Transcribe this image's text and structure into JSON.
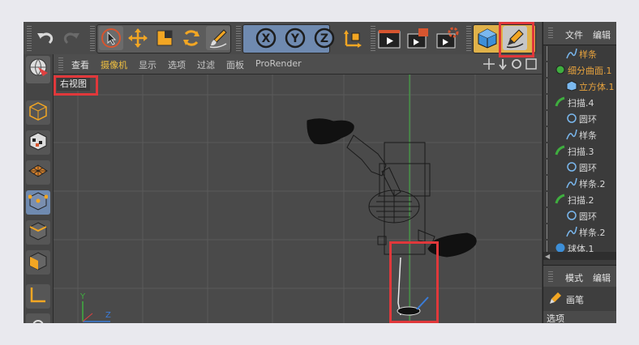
{
  "toolbar": {
    "undo_icon": "undo-icon",
    "redo_icon": "redo-icon",
    "tools": [
      "select-icon",
      "move-icon",
      "scale-icon",
      "rotate-icon",
      "brush-icon"
    ],
    "axes": [
      "X",
      "Y",
      "Z"
    ],
    "render_icons": [
      "render-view-icon",
      "render-picture-icon",
      "render-settings-icon"
    ],
    "cube_icon": "cube-icon",
    "pen_icon": "pen-tool-icon"
  },
  "viewport_menu": {
    "items": [
      "查看",
      "摄像机",
      "显示",
      "选项",
      "过滤",
      "面板",
      "ProRender"
    ],
    "view_name": "右视图"
  },
  "axis_labels": {
    "y": "Y",
    "z": "Z"
  },
  "object_manager": {
    "tabs": [
      "文件",
      "编辑"
    ],
    "items": [
      {
        "label": "样条",
        "indent": 1,
        "color": "#e8a33d",
        "icon": "spline-icon"
      },
      {
        "label": "细分曲面.1",
        "indent": 0,
        "color": "#e8a33d",
        "icon": "subdivision-icon"
      },
      {
        "label": "立方体.1",
        "indent": 1,
        "color": "#e8a33d",
        "icon": "cube-icon"
      },
      {
        "label": "扫描.4",
        "indent": 0,
        "color": "#d8d8d8",
        "icon": "sweep-icon"
      },
      {
        "label": "圆环",
        "indent": 1,
        "color": "#d8d8d8",
        "icon": "circle-icon"
      },
      {
        "label": "样条",
        "indent": 1,
        "color": "#d8d8d8",
        "icon": "spline-icon"
      },
      {
        "label": "扫描.3",
        "indent": 0,
        "color": "#d8d8d8",
        "icon": "sweep-icon"
      },
      {
        "label": "圆环",
        "indent": 1,
        "color": "#d8d8d8",
        "icon": "circle-icon"
      },
      {
        "label": "样条.2",
        "indent": 1,
        "color": "#d8d8d8",
        "icon": "spline-icon"
      },
      {
        "label": "扫描.2",
        "indent": 0,
        "color": "#d8d8d8",
        "icon": "sweep-icon"
      },
      {
        "label": "圆环",
        "indent": 1,
        "color": "#d8d8d8",
        "icon": "circle-icon"
      },
      {
        "label": "样条.2",
        "indent": 1,
        "color": "#d8d8d8",
        "icon": "spline-icon"
      },
      {
        "label": "球体.1",
        "indent": 0,
        "color": "#d8d8d8",
        "icon": "sphere-icon"
      }
    ]
  },
  "attribute_manager": {
    "tabs": [
      "模式",
      "编辑"
    ],
    "object_label": "画笔",
    "section": "选项"
  }
}
